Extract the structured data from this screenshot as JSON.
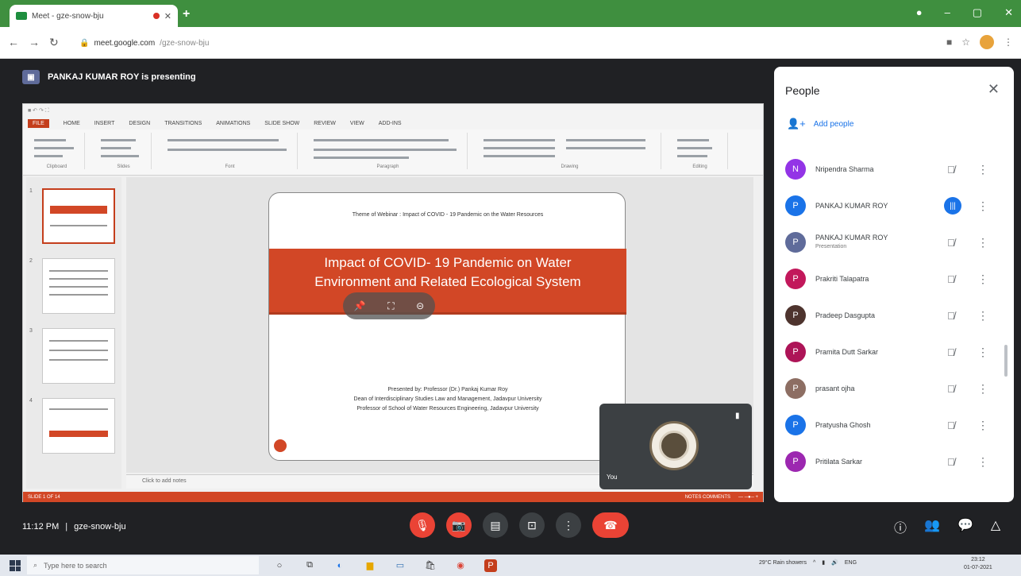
{
  "browser": {
    "tab_title": "Meet - gze-snow-bju",
    "url_host": "meet.google.com",
    "url_path": "/gze-snow-bju"
  },
  "meet": {
    "presenting_label": "PANKAJ KUMAR ROY is presenting",
    "meeting_code": "gze-snow-bju",
    "time": "11:12 PM",
    "self_name": "You"
  },
  "ppt": {
    "menu": [
      "FILE",
      "HOME",
      "INSERT",
      "DESIGN",
      "TRANSITIONS",
      "ANIMATIONS",
      "SLIDE SHOW",
      "REVIEW",
      "VIEW",
      "ADD-INS"
    ],
    "ribbon_groups": [
      "Clipboard",
      "Slides",
      "Font",
      "Paragraph",
      "Drawing",
      "Editing"
    ],
    "notes_placeholder": "Click to add notes",
    "status_left": "SLIDE 1 OF 14",
    "status_right": "NOTES   COMMENTS"
  },
  "slide": {
    "header": "Theme of Webinar : Impact of COVID - 19 Pandemic on the Water Resources",
    "title": "Impact of COVID- 19 Pandemic on Water Environment and Related Ecological System",
    "presenter_lines": [
      "Presented by: Professor (Dr.) Pankaj Kumar Roy",
      "Dean of Interdisciplinary Studies Law and Management, Jadavpur University",
      "Professor of School of Water Resources Engineering, Jadavpur University"
    ]
  },
  "people": {
    "title": "People",
    "add_label": "Add people",
    "list": [
      {
        "initial": "N",
        "name": "Nripendra Sharma",
        "sub": "",
        "color": "#9334e6"
      },
      {
        "initial": "P",
        "name": "PANKAJ KUMAR ROY",
        "sub": "",
        "color": "#1a73e8"
      },
      {
        "initial": "P",
        "name": "PANKAJ KUMAR ROY",
        "sub": "Presentation",
        "color": "#5f6b9a"
      },
      {
        "initial": "P",
        "name": "Prakriti Talapatra",
        "sub": "",
        "color": "#c2185b"
      },
      {
        "initial": "P",
        "name": "Pradeep Dasgupta",
        "sub": "",
        "color": "#4e342e"
      },
      {
        "initial": "P",
        "name": "Pramita Dutt Sarkar",
        "sub": "",
        "color": "#ad1457"
      },
      {
        "initial": "P",
        "name": "prasant ojha",
        "sub": "",
        "color": "#8d6e63"
      },
      {
        "initial": "P",
        "name": "Pratyusha Ghosh",
        "sub": "",
        "color": "#1a73e8"
      },
      {
        "initial": "P",
        "name": "Pritilata Sarkar",
        "sub": "",
        "color": "#9c27b0"
      }
    ]
  },
  "taskbar": {
    "search_placeholder": "Type here to search",
    "weather": "29°C Rain showers",
    "lang": "ENG",
    "time": "23:12",
    "date": "01-07-2021"
  }
}
